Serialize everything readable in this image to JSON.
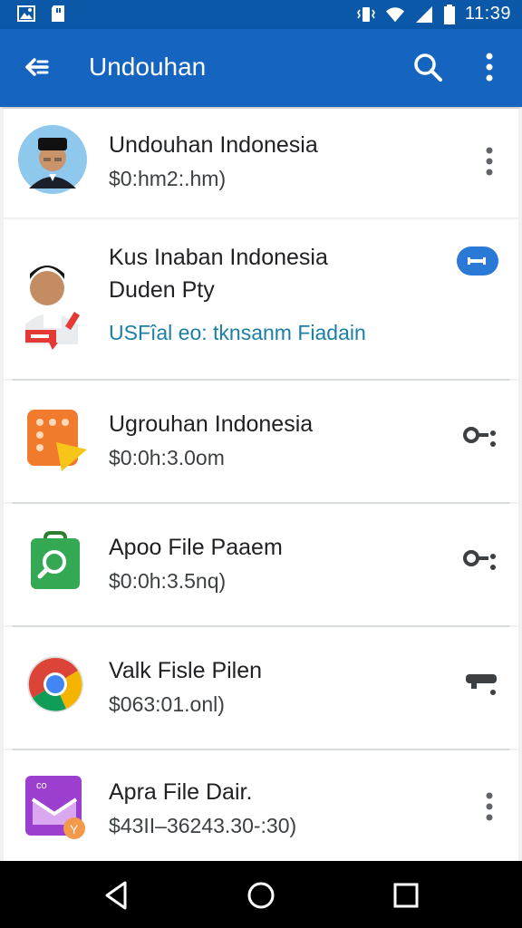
{
  "status_bar": {
    "time": "11:39",
    "icons": [
      "image-icon",
      "sd-card-icon",
      "vibrate-icon",
      "wifi-icon",
      "signal-icon",
      "battery-icon"
    ]
  },
  "app_bar": {
    "title": "Undouhan",
    "icons": [
      "back-arrow-icon",
      "search-icon",
      "more-vert-icon"
    ]
  },
  "items": [
    {
      "title": "Undouhan Indonesia",
      "subtitle": "$0:hm2:.hm)",
      "icon": "person-avatar",
      "action_icon": "more-vert-icon"
    },
    {
      "title": "Kus Inaban Indonesia",
      "title2": "Duden Pty",
      "subtitle": "USFîal eo: tknsanm Fiadain",
      "icon": "person-avatar-badge",
      "action_icon": "cloud-toggle-icon",
      "accent": "#1a7fa6"
    },
    {
      "title": "Ugrouhan Indonesia",
      "subtitle": "$0:0h:3.0om",
      "icon": "app-grid-icon",
      "action_icon": "key-icon"
    },
    {
      "title": "Apoo File Paaem",
      "subtitle": "$0:0h:3.5nq)",
      "icon": "search-app-icon",
      "action_icon": "key-icon"
    },
    {
      "title": "Valk Fisle Pilen",
      "subtitle": "$063:01.onl)",
      "icon": "chrome-icon",
      "action_icon": "key-icon"
    },
    {
      "title": "Apra File Dair.",
      "subtitle": "$43II–36243.30-:30)",
      "icon": "mail-app-icon",
      "action_icon": "more-vert-icon"
    }
  ],
  "nav_bar": {
    "icons": [
      "back-nav-icon",
      "home-nav-icon",
      "recents-nav-icon"
    ]
  },
  "colors": {
    "status_bar": "#0b57a8",
    "app_bar": "#1565c0",
    "accent": "#1a7fa6",
    "toggle": "#2b79d6"
  }
}
